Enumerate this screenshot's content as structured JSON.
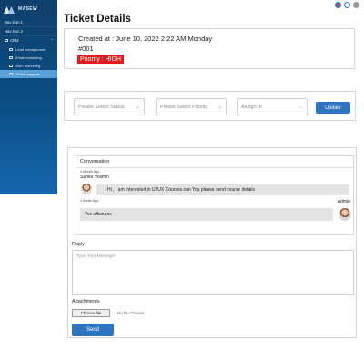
{
  "sidebar": {
    "logo_text": "MASEW",
    "nav_items": [
      {
        "label": "Nav item 1"
      },
      {
        "label": "Nav item 2"
      }
    ],
    "crm_label": "CRM",
    "crm_chevron": "⌃",
    "sub_items": [
      {
        "label": "Lead management",
        "icon": "lead-icon"
      },
      {
        "label": "Email marketing",
        "icon": "email-icon"
      },
      {
        "label": "SMS marketing",
        "icon": "sms-icon"
      },
      {
        "label": "Online support",
        "icon": "support-icon",
        "active": true
      }
    ]
  },
  "page": {
    "title": "Ticket Details"
  },
  "ticket": {
    "created": "Created at : June 10, 2022 2:22 AM  Monday",
    "number": "#001",
    "priority": "Priority : HIGH",
    "priority_color": "#e11b1b"
  },
  "filters": {
    "status_placeholder": "Please Select Status",
    "priority_placeholder": "Please Select Priority",
    "assign_placeholder": "Assign to",
    "chevron": "⌄",
    "update_label": "Update"
  },
  "conversation": {
    "title": "Conversation",
    "messages": [
      {
        "time": "4 Month Ago",
        "name": "Samia Yeamin",
        "text": "Hi , I am Interested in UI/UX Courses.can You please send course details"
      },
      {
        "time": "1 Week Ago",
        "name": "Admin",
        "text": "Yes offcourse"
      }
    ]
  },
  "reply": {
    "label": "Reply",
    "placeholder": "Type Your Message"
  },
  "attachments": {
    "label": "Attachments",
    "choose_label": "Choose file",
    "no_file": "No file Chosen"
  },
  "send_label": "Send",
  "colors": {
    "accent": "#2f74c0",
    "sidebar": "#0a4f86",
    "priority": "#e11b1b"
  }
}
